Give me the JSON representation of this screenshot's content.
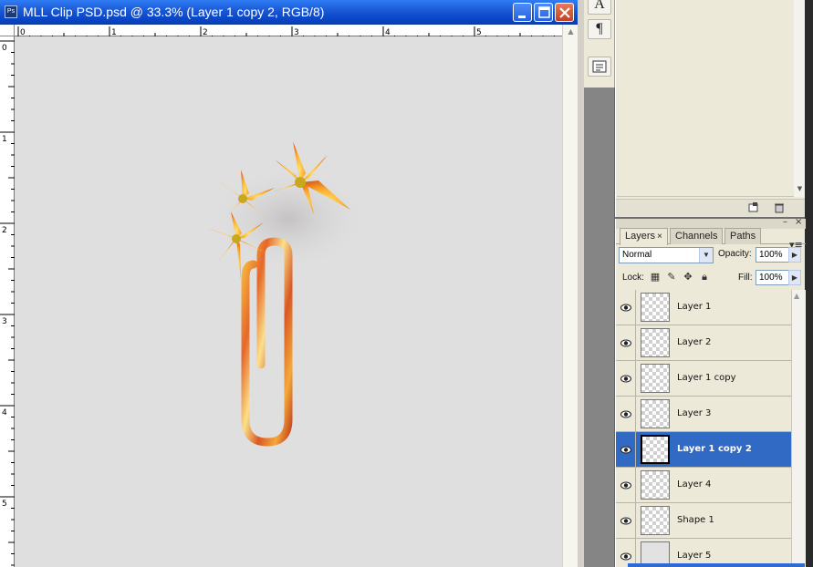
{
  "document": {
    "title": "MLL Clip PSD.psd @ 33.3% (Layer 1 copy 2, RGB/8)",
    "app_icon_label": "Ps",
    "window_buttons": [
      "minimize",
      "maximize",
      "close"
    ]
  },
  "rulers": {
    "horizontal_labels": [
      "0",
      "1",
      "2",
      "3",
      "4",
      "5"
    ],
    "vertical_labels": [
      "0",
      "1",
      "2",
      "3",
      "4",
      "5"
    ]
  },
  "tools": {
    "character_glyph": "A",
    "paragraph_glyph": "¶"
  },
  "layers_panel": {
    "tabs": [
      {
        "label": "Layers",
        "active": true
      },
      {
        "label": "Channels",
        "active": false
      },
      {
        "label": "Paths",
        "active": false
      }
    ],
    "blend_mode": "Normal",
    "opacity_label": "Opacity:",
    "opacity_value": "100%",
    "lock_label": "Lock:",
    "fill_label": "Fill:",
    "fill_value": "100%",
    "layers": [
      {
        "name": "Layer 1",
        "visible": true,
        "selected": false
      },
      {
        "name": "Layer 2",
        "visible": true,
        "selected": false
      },
      {
        "name": "Layer 1 copy",
        "visible": true,
        "selected": false
      },
      {
        "name": "Layer 3",
        "visible": true,
        "selected": false
      },
      {
        "name": "Layer 1 copy 2",
        "visible": true,
        "selected": true
      },
      {
        "name": "Layer 4",
        "visible": true,
        "selected": false
      },
      {
        "name": "Shape 1",
        "visible": true,
        "selected": false
      },
      {
        "name": "Layer 5",
        "visible": true,
        "selected": false
      }
    ]
  },
  "colors": {
    "titlebar": "#1958d6",
    "selection": "#316ac5",
    "canvas": "#e0dfe0"
  }
}
